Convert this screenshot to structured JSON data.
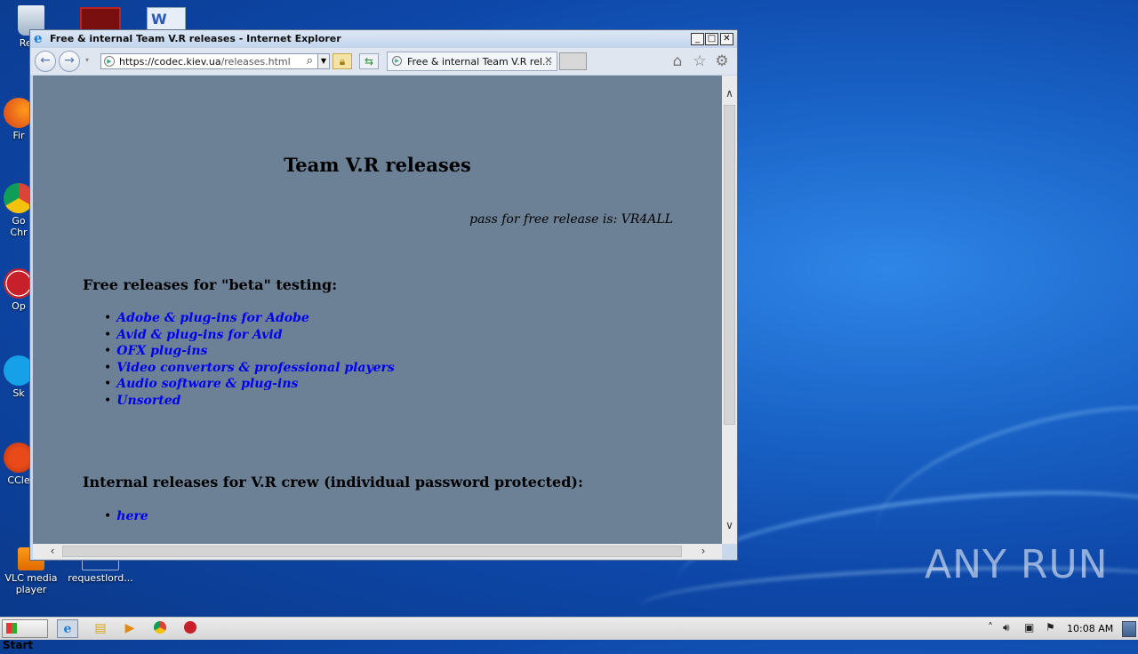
{
  "window": {
    "title": "Free &  internal Team V.R releases - Internet Explorer",
    "minimize": "_",
    "maximize": "□",
    "close": "✕"
  },
  "navbar": {
    "url_prefix": "https://codec.kiev.ua",
    "url_path": "/releases.html",
    "tab_label": "Free &  internal Team V.R rel...",
    "icons": [
      "back-icon",
      "forward-icon",
      "search-icon",
      "lock-icon",
      "refresh-icon",
      "home-icon",
      "star-icon",
      "gear-icon"
    ]
  },
  "page": {
    "heading": "Team V.R releases",
    "pass_note": "pass for free release is: VR4ALL",
    "free_heading": "Free releases for \"beta\" testing:",
    "free_links": [
      "Adobe & plug-ins for Adobe",
      "Avid & plug-ins for Avid",
      "OFX plug-ins",
      "Video convertors & professional players",
      "Audio software & plug-ins",
      "Unsorted"
    ],
    "internal_heading": "Internal releases for V.R crew (individual password protected):",
    "internal_links": [
      "here"
    ],
    "background_color": "#6c8196",
    "link_color": "#0000ee"
  },
  "desktop": {
    "icons": [
      {
        "label": "Recy"
      },
      {
        "label": "Fir"
      },
      {
        "label": "Go\nChr"
      },
      {
        "label": "Op"
      },
      {
        "label": "Sk"
      },
      {
        "label": "CCle"
      },
      {
        "label": "VLC media player"
      },
      {
        "label": "requestlord..."
      }
    ],
    "watermark": "ANY RUN"
  },
  "taskbar": {
    "start_label": "Start",
    "clock": "10:08 AM"
  }
}
